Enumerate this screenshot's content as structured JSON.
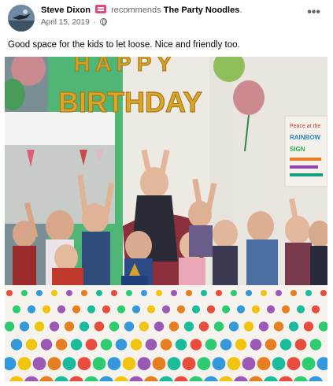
{
  "post": {
    "author": "Steve Dixon",
    "verb": "recommends",
    "page": "The Party Noodles",
    "page_suffix": ".",
    "date": "April 15, 2019",
    "dot": "·",
    "text": "Good space for the kids to let loose. Nice and friendly too.",
    "more_label": "•••"
  },
  "photo": {
    "banner": "HAPPY BIRTHDAY",
    "sign_lines": [
      "Peace at the",
      "RAINBOW",
      "SIGN"
    ],
    "colors": {
      "wall": "#e8e4df",
      "green_wall": "#4bb86e",
      "balloon_gold": "#d9a62a",
      "tablecloth": "#f5f2ec"
    }
  },
  "icons": {
    "avatar": "avatar-icon",
    "recommend": "recommend-flag-icon",
    "privacy": "globe-icon",
    "more": "more-options-icon"
  }
}
